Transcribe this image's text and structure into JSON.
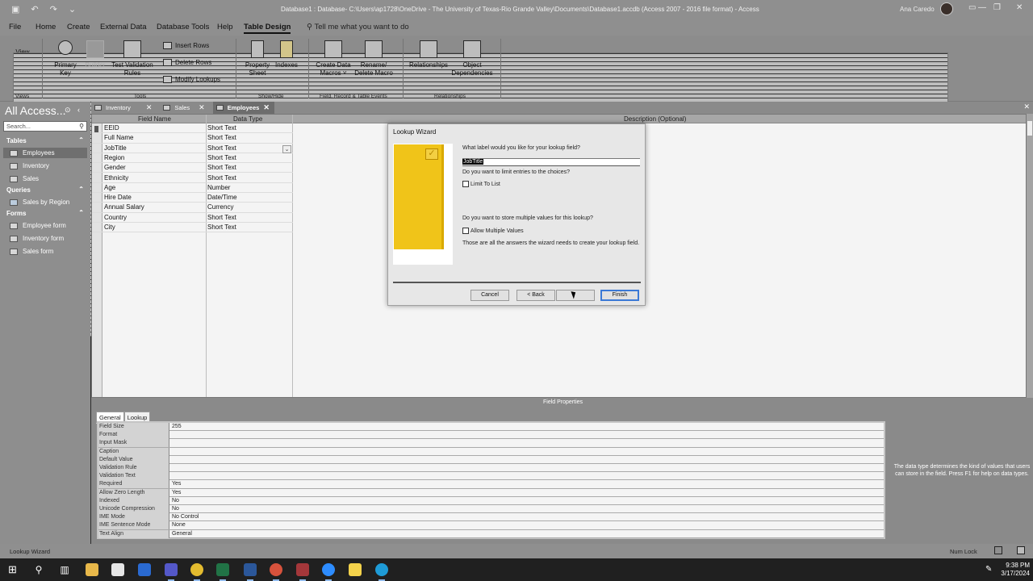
{
  "window": {
    "title": "Database1 : Database- C:\\Users\\ap1728\\OneDrive - The University of Texas-Rio Grande Valley\\Documents\\Database1.accdb (Access 2007 - 2016 file format) - Access",
    "user": "Ana Caredo"
  },
  "menu": {
    "items": [
      "File",
      "Home",
      "Create",
      "External Data",
      "Database Tools",
      "Help",
      "Table Design"
    ],
    "active": "Table Design",
    "tell_me": "Tell me what you want to do"
  },
  "ribbon": {
    "view": "View",
    "primary_key": [
      "Primary",
      "Key"
    ],
    "builder": "Builder",
    "test_validation": [
      "Test Validation",
      "Rules"
    ],
    "insert_rows": "Insert Rows",
    "delete_rows": "Delete Rows",
    "modify_lookups": "Modify Lookups",
    "property_sheet": [
      "Property",
      "Sheet"
    ],
    "indexes": "Indexes",
    "create_data_macros": [
      "Create Data",
      "Macros ˅"
    ],
    "rename_delete_macro": [
      "Rename/",
      "Delete Macro"
    ],
    "relationships": "Relationships",
    "object_dependencies": [
      "Object",
      "Dependencies"
    ],
    "groups": [
      "Views",
      "Tools",
      "Show/Hide",
      "Field, Record & Table Events",
      "Relationships"
    ]
  },
  "nav": {
    "title": "All Access...",
    "search_placeholder": "Search...",
    "sections": [
      {
        "label": "Tables",
        "items": [
          "Employees",
          "Inventory",
          "Sales"
        ]
      },
      {
        "label": "Queries",
        "items": [
          "Sales by Region"
        ]
      },
      {
        "label": "Forms",
        "items": [
          "Employee form",
          "Inventory form",
          "Sales form"
        ]
      }
    ],
    "selected": "Employees"
  },
  "tabs": [
    "Inventory",
    "Sales",
    "Employees"
  ],
  "active_tab": "Employees",
  "design_grid": {
    "headers": [
      "Field Name",
      "Data Type",
      "Description (Optional)"
    ],
    "rows": [
      {
        "field": "EEID",
        "type": "Short Text"
      },
      {
        "field": "Full Name",
        "type": "Short Text"
      },
      {
        "field": "JobTitle",
        "type": "Short Text"
      },
      {
        "field": "Region",
        "type": "Short Text"
      },
      {
        "field": "Gender",
        "type": "Short Text"
      },
      {
        "field": "Ethnicity",
        "type": "Short Text"
      },
      {
        "field": "Age",
        "type": "Number"
      },
      {
        "field": "Hire Date",
        "type": "Date/Time"
      },
      {
        "field": "Annual Salary",
        "type": "Currency"
      },
      {
        "field": "Country",
        "type": "Short Text"
      },
      {
        "field": "City",
        "type": "Short Text"
      }
    ]
  },
  "field_properties": {
    "label": "Field Properties",
    "tabs": [
      "General",
      "Lookup"
    ],
    "rows": [
      {
        "name": "Field Size",
        "value": "255"
      },
      {
        "name": "Format",
        "value": ""
      },
      {
        "name": "Input Mask",
        "value": ""
      },
      {
        "name": "Caption",
        "value": ""
      },
      {
        "name": "Default Value",
        "value": ""
      },
      {
        "name": "Validation Rule",
        "value": ""
      },
      {
        "name": "Validation Text",
        "value": ""
      },
      {
        "name": "Required",
        "value": "Yes"
      },
      {
        "name": "Allow Zero Length",
        "value": "Yes"
      },
      {
        "name": "Indexed",
        "value": "No"
      },
      {
        "name": "Unicode Compression",
        "value": "No"
      },
      {
        "name": "IME Mode",
        "value": "No Control"
      },
      {
        "name": "IME Sentence Mode",
        "value": "None"
      },
      {
        "name": "Text Align",
        "value": "General"
      }
    ],
    "help": "The data type determines the kind of values that users can store in the field. Press F1 for help on data types."
  },
  "wizard": {
    "title": "Lookup Wizard",
    "q_label": "What label would you like for your lookup field?",
    "label_value": "JobTitle",
    "q_limit": "Do you want to limit entries to the choices?",
    "limit_to_list": "Limit To List",
    "q_multiple": "Do you want to store multiple values for this lookup?",
    "allow_multiple": "Allow Multiple Values",
    "done_text": "Those are all the answers the wizard needs to create your lookup field.",
    "buttons": {
      "cancel": "Cancel",
      "back": "< Back",
      "next": "Next >",
      "finish": "Finish"
    }
  },
  "status": {
    "left": "Lookup Wizard",
    "right": "Num Lock"
  },
  "clock": {
    "time": "9:38 PM",
    "date": "3/17/2024"
  },
  "colors": {
    "access_red": "#a4373a",
    "word_blue": "#2b579a",
    "excel_green": "#217346"
  }
}
